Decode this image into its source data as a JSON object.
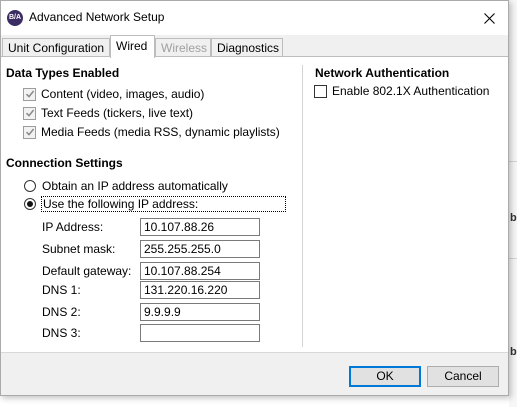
{
  "window": {
    "icon_text": "B/A",
    "title": "Advanced Network Setup"
  },
  "tabs": [
    {
      "label": "Unit Configuration",
      "state": "normal"
    },
    {
      "label": "Wired",
      "state": "active"
    },
    {
      "label": "Wireless",
      "state": "disabled"
    },
    {
      "label": "Diagnostics",
      "state": "normal"
    }
  ],
  "data_types": {
    "title": "Data Types Enabled",
    "items": [
      {
        "label": "Content (video, images, audio)",
        "checked": true
      },
      {
        "label": "Text Feeds (tickers, live text)",
        "checked": true
      },
      {
        "label": "Media Feeds (media RSS, dynamic playlists)",
        "checked": true
      }
    ]
  },
  "connection": {
    "title": "Connection Settings",
    "options": [
      {
        "label": "Obtain an IP address automatically",
        "selected": false
      },
      {
        "label": "Use the following IP address:",
        "selected": true
      }
    ],
    "fields": [
      {
        "label": "IP Address:",
        "value": "10.107.88.26"
      },
      {
        "label": "Subnet mask:",
        "value": "255.255.255.0"
      },
      {
        "label": "Default gateway:",
        "value": "10.107.88.254"
      },
      {
        "label": "DNS 1:",
        "value": "131.220.16.220"
      },
      {
        "label": "DNS 2:",
        "value": "9.9.9.9"
      },
      {
        "label": "DNS 3:",
        "value": ""
      }
    ]
  },
  "network_auth": {
    "title": "Network Authentication",
    "checkbox_label": "Enable 802.1X Authentication",
    "checked": false
  },
  "buttons": {
    "ok": "OK",
    "cancel": "Cancel"
  },
  "colors": {
    "accent": "#0078d7",
    "icon_bg": "#3b2d63",
    "disabled_text": "#a0a0a0"
  }
}
